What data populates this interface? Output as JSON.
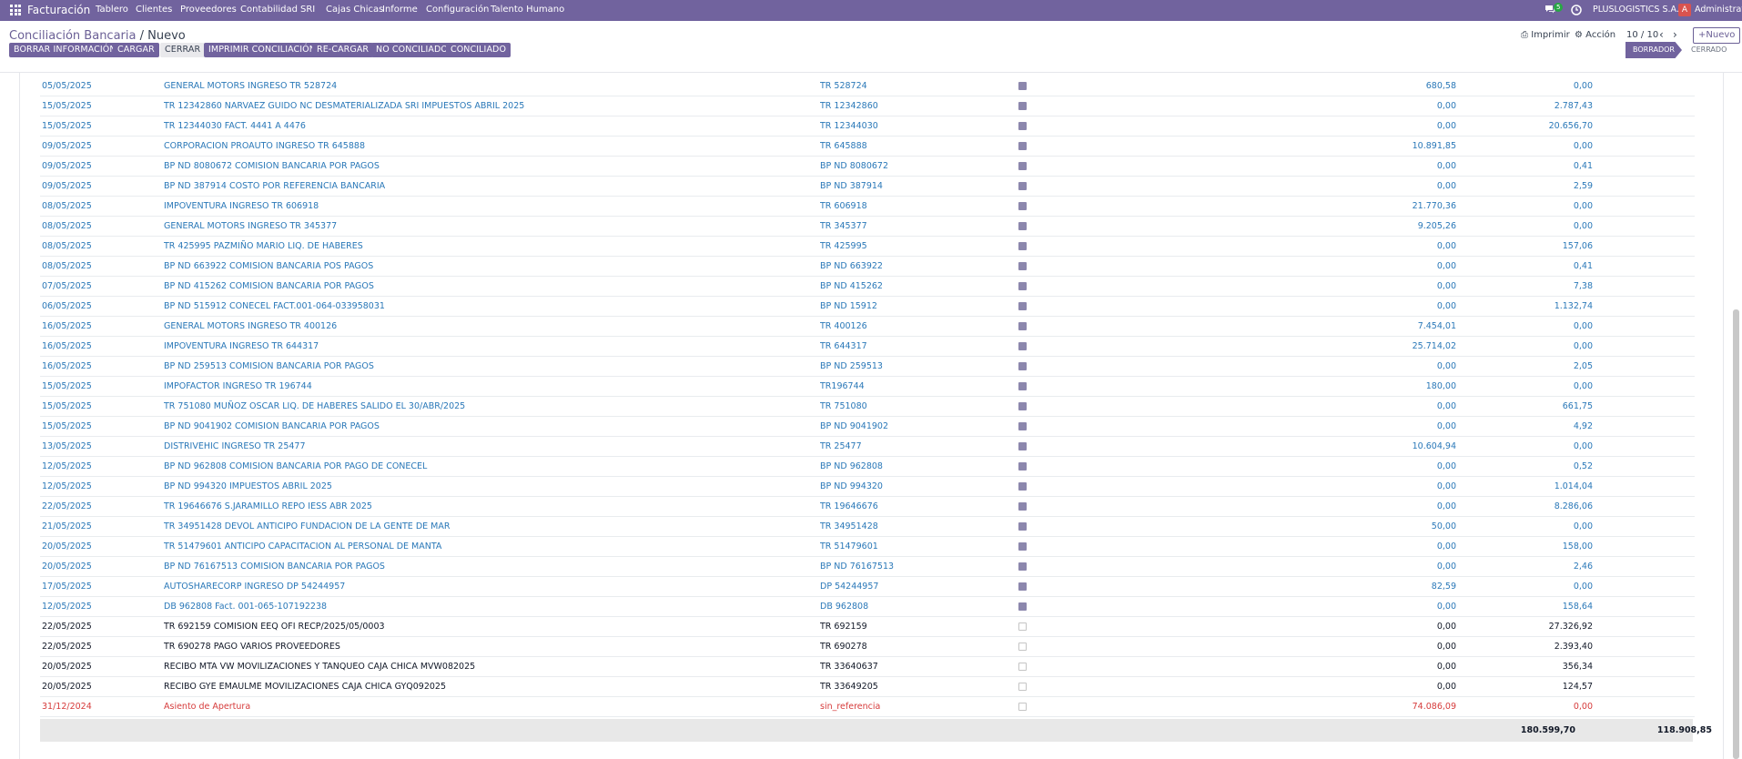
{
  "topbar": {
    "app_name": "Facturación",
    "menu": [
      "Tablero",
      "Clientes",
      "Proveedores",
      "Contabilidad",
      "SRI",
      "Cajas Chicas",
      "Informe",
      "Configuración",
      "Talento Humano"
    ],
    "chat_badge": "5",
    "company": "PLUSLOGISTICS S.A.",
    "avatar_letter": "A",
    "user": "Administrator"
  },
  "control": {
    "breadcrumb_parent": "Conciliación Bancaria",
    "breadcrumb_sep": " / ",
    "breadcrumb_current": "Nuevo",
    "print_label": "Imprimir",
    "action_label": "Acción",
    "pager": "10 / 10",
    "new_label": "Nuevo"
  },
  "actions": {
    "borrar": "BORRAR INFORMACIÓN",
    "cargar": "CARGAR",
    "cerrar": "CERRAR",
    "imprimir": "IMPRIMIR CONCILIACIÓN",
    "recargar": "RE-CARGAR",
    "no_conciliado": "NO CONCILIADO",
    "conciliado": "CONCILIADO"
  },
  "status": {
    "active": "BORRADOR",
    "inactive": "CERRADO"
  },
  "rows": [
    {
      "date": "05/05/2025",
      "desc": "GENERAL MOTORS INGRESO TR 528724",
      "ref": "TR 528724",
      "checked": true,
      "debit": "680,58",
      "credit": "0,00",
      "state": "rec"
    },
    {
      "date": "15/05/2025",
      "desc": "TR 12342860 NARVAEZ GUIDO NC DESMATERIALIZADA SRI IMPUESTOS ABRIL 2025",
      "ref": "TR 12342860",
      "checked": true,
      "debit": "0,00",
      "credit": "2.787,43",
      "state": "rec"
    },
    {
      "date": "15/05/2025",
      "desc": "TR 12344030 FACT. 4441 A 4476",
      "ref": "TR 12344030",
      "checked": true,
      "debit": "0,00",
      "credit": "20.656,70",
      "state": "rec"
    },
    {
      "date": "09/05/2025",
      "desc": "CORPORACION PROAUTO INGRESO TR 645888",
      "ref": "TR 645888",
      "checked": true,
      "debit": "10.891,85",
      "credit": "0,00",
      "state": "rec"
    },
    {
      "date": "09/05/2025",
      "desc": "BP ND 8080672 COMISION BANCARIA POR PAGOS",
      "ref": "BP ND 8080672",
      "checked": true,
      "debit": "0,00",
      "credit": "0,41",
      "state": "rec"
    },
    {
      "date": "09/05/2025",
      "desc": "BP ND 387914 COSTO POR REFERENCIA BANCARIA",
      "ref": "BP ND 387914",
      "checked": true,
      "debit": "0,00",
      "credit": "2,59",
      "state": "rec"
    },
    {
      "date": "08/05/2025",
      "desc": "IMPOVENTURA INGRESO TR 606918",
      "ref": "TR 606918",
      "checked": true,
      "debit": "21.770,36",
      "credit": "0,00",
      "state": "rec"
    },
    {
      "date": "08/05/2025",
      "desc": "GENERAL MOTORS INGRESO TR 345377",
      "ref": "TR 345377",
      "checked": true,
      "debit": "9.205,26",
      "credit": "0,00",
      "state": "rec"
    },
    {
      "date": "08/05/2025",
      "desc": "TR 425995 PAZMIÑO MARIO LIQ. DE HABERES",
      "ref": "TR 425995",
      "checked": true,
      "debit": "0,00",
      "credit": "157,06",
      "state": "rec"
    },
    {
      "date": "08/05/2025",
      "desc": "BP ND 663922 COMISION BANCARIA POS PAGOS",
      "ref": "BP ND 663922",
      "checked": true,
      "debit": "0,00",
      "credit": "0,41",
      "state": "rec"
    },
    {
      "date": "07/05/2025",
      "desc": "BP ND 415262 COMISION BANCARIA POR PAGOS",
      "ref": "BP ND 415262",
      "checked": true,
      "debit": "0,00",
      "credit": "7,38",
      "state": "rec"
    },
    {
      "date": "06/05/2025",
      "desc": "BP ND 515912 CONECEL FACT.001-064-033958031",
      "ref": "BP ND 15912",
      "checked": true,
      "debit": "0,00",
      "credit": "1.132,74",
      "state": "rec"
    },
    {
      "date": "16/05/2025",
      "desc": "GENERAL MOTORS INGRESO TR 400126",
      "ref": "TR 400126",
      "checked": true,
      "debit": "7.454,01",
      "credit": "0,00",
      "state": "rec"
    },
    {
      "date": "16/05/2025",
      "desc": "IMPOVENTURA INGRESO TR 644317",
      "ref": "TR 644317",
      "checked": true,
      "debit": "25.714,02",
      "credit": "0,00",
      "state": "rec"
    },
    {
      "date": "16/05/2025",
      "desc": "BP ND 259513 COMISION BANCARIA POR PAGOS",
      "ref": "BP ND 259513",
      "checked": true,
      "debit": "0,00",
      "credit": "2,05",
      "state": "rec"
    },
    {
      "date": "15/05/2025",
      "desc": "IMPOFACTOR INGRESO TR 196744",
      "ref": "TR196744",
      "checked": true,
      "debit": "180,00",
      "credit": "0,00",
      "state": "rec"
    },
    {
      "date": "15/05/2025",
      "desc": "TR 751080 MUÑOZ OSCAR LIQ. DE HABERES SALIDO EL 30/ABR/2025",
      "ref": "TR 751080",
      "checked": true,
      "debit": "0,00",
      "credit": "661,75",
      "state": "rec"
    },
    {
      "date": "15/05/2025",
      "desc": "BP ND 9041902 COMISION BANCARIA POR PAGOS",
      "ref": "BP ND 9041902",
      "checked": true,
      "debit": "0,00",
      "credit": "4,92",
      "state": "rec"
    },
    {
      "date": "13/05/2025",
      "desc": "DISTRIVEHIC INGRESO TR 25477",
      "ref": "TR 25477",
      "checked": true,
      "debit": "10.604,94",
      "credit": "0,00",
      "state": "rec"
    },
    {
      "date": "12/05/2025",
      "desc": "BP ND 962808 COMISION BANCARIA POR PAGO DE CONECEL",
      "ref": "BP ND 962808",
      "checked": true,
      "debit": "0,00",
      "credit": "0,52",
      "state": "rec"
    },
    {
      "date": "12/05/2025",
      "desc": "BP ND 994320 IMPUESTOS ABRIL 2025",
      "ref": "BP ND 994320",
      "checked": true,
      "debit": "0,00",
      "credit": "1.014,04",
      "state": "rec"
    },
    {
      "date": "22/05/2025",
      "desc": "TR 19646676 S.JARAMILLO REPO IESS ABR 2025",
      "ref": "TR 19646676",
      "checked": true,
      "debit": "0,00",
      "credit": "8.286,06",
      "state": "rec"
    },
    {
      "date": "21/05/2025",
      "desc": "TR 34951428 DEVOL ANTICIPO FUNDACION DE LA GENTE DE MAR",
      "ref": "TR 34951428",
      "checked": true,
      "debit": "50,00",
      "credit": "0,00",
      "state": "rec"
    },
    {
      "date": "20/05/2025",
      "desc": "TR 51479601 ANTICIPO CAPACITACION AL PERSONAL DE MANTA",
      "ref": "TR 51479601",
      "checked": true,
      "debit": "0,00",
      "credit": "158,00",
      "state": "rec"
    },
    {
      "date": "20/05/2025",
      "desc": "BP ND 76167513 COMISION BANCARIA POR PAGOS",
      "ref": "BP ND 76167513",
      "checked": true,
      "debit": "0,00",
      "credit": "2,46",
      "state": "rec"
    },
    {
      "date": "17/05/2025",
      "desc": "AUTOSHARECORP INGRESO DP 54244957",
      "ref": "DP 54244957",
      "checked": true,
      "debit": "82,59",
      "credit": "0,00",
      "state": "rec"
    },
    {
      "date": "12/05/2025",
      "desc": "DB 962808 Fact. 001-065-107192238",
      "ref": "DB 962808",
      "checked": true,
      "debit": "0,00",
      "credit": "158,64",
      "state": "rec"
    },
    {
      "date": "22/05/2025",
      "desc": "TR 692159 COMISION EEQ OFI RECP/2025/05/0003",
      "ref": "TR 692159",
      "checked": false,
      "debit": "0,00",
      "credit": "27.326,92",
      "state": "unrec"
    },
    {
      "date": "22/05/2025",
      "desc": "TR 690278 PAGO VARIOS PROVEEDORES",
      "ref": "TR 690278",
      "checked": false,
      "debit": "0,00",
      "credit": "2.393,40",
      "state": "unrec"
    },
    {
      "date": "20/05/2025",
      "desc": "RECIBO MTA VW MOVILIZACIONES Y TANQUEO CAJA CHICA MVW082025",
      "ref": "TR 33640637",
      "checked": false,
      "debit": "0,00",
      "credit": "356,34",
      "state": "unrec"
    },
    {
      "date": "20/05/2025",
      "desc": "RECIBO GYE EMAULME MOVILIZACIONES CAJA CHICA GYQ092025",
      "ref": "TR 33649205",
      "checked": false,
      "debit": "0,00",
      "credit": "124,57",
      "state": "unrec"
    },
    {
      "date": "31/12/2024",
      "desc": "Asiento de Apertura",
      "ref": "sin_referencia",
      "checked": false,
      "debit": "74.086,09",
      "credit": "0,00",
      "state": "open"
    }
  ],
  "totals": {
    "debit": "180.599,70",
    "credit": "118.908,85"
  },
  "colors": {
    "brand": "#71639e",
    "link": "#2a78b8",
    "opening": "#d63b3b",
    "badge": "#28a745"
  }
}
